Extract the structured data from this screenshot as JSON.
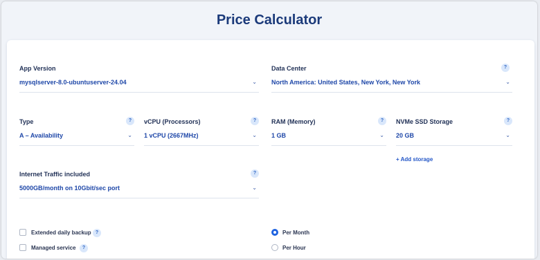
{
  "title": "Price Calculator",
  "help_glyph": "?",
  "chevron_glyph": "⌄",
  "fields": {
    "app_version": {
      "label": "App Version",
      "value": "mysqlserver-8.0-ubuntuserver-24.04"
    },
    "data_center": {
      "label": "Data Center",
      "value": "North America: United States, New York, New York"
    },
    "type": {
      "label": "Type",
      "value": "A – Availability"
    },
    "vcpu": {
      "label": "vCPU (Processors)",
      "value": "1 vCPU (2667MHz)"
    },
    "ram": {
      "label": "RAM (Memory)",
      "value": "1 GB"
    },
    "storage": {
      "label": "NVMe SSD Storage",
      "value": "20 GB"
    },
    "traffic": {
      "label": "Internet Traffic included",
      "value": "5000GB/month on 10Gbit/sec port"
    }
  },
  "add_storage": "+ Add storage",
  "options": {
    "backup": {
      "label": "Extended daily backup",
      "checked": false
    },
    "managed": {
      "label": "Managed service",
      "checked": false
    }
  },
  "billing": {
    "per_month": "Per Month",
    "per_hour": "Per Hour",
    "selected": "Per Month"
  },
  "colors": {
    "accent": "#1f63e0",
    "title": "#1b3a7a",
    "value": "#1e47a8"
  }
}
